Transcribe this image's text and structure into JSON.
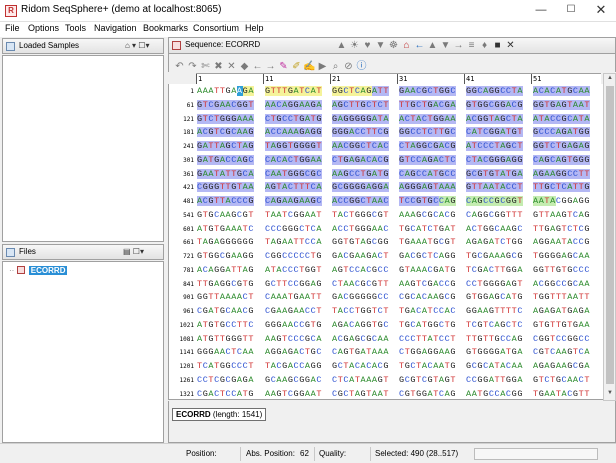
{
  "window": {
    "title": "Ridom SeqSphere+ (demo at localhost:8065)",
    "app_icon_letter": "R",
    "min_glyph": "—",
    "max_glyph": "☐",
    "close_glyph": "✕"
  },
  "menu": [
    "File",
    "Options",
    "Tools",
    "Navigation",
    "Bookmarks",
    "Consortium",
    "Help"
  ],
  "panels": {
    "loaded_samples": {
      "title": "Loaded Samples",
      "controls": "⌂ ▾  ☐▾"
    },
    "files": {
      "title": "Files",
      "controls": "▤  ☐▾",
      "tree_dots": "··",
      "tree_item": "ECORRD"
    }
  },
  "sequence_panel": {
    "title": "Sequence: ECORRD",
    "header_icons": [
      "▲",
      "☀",
      "♥",
      "▼",
      "☸",
      "⌂",
      "←",
      "▲",
      "▼",
      "→",
      "≡",
      "♦",
      "■",
      "✕"
    ],
    "toolbar_icons": [
      "↶",
      "↷",
      "✄",
      "✖",
      "✕",
      "◆",
      "←",
      "→",
      "✎",
      "✐",
      "✍",
      "▶",
      "⌕",
      "⊘",
      "ⓘ"
    ],
    "info_name": "ECORRD",
    "info_length": "(length: 1541)"
  },
  "ruler": {
    "marks": [
      "1",
      "11",
      "21",
      "31",
      "41",
      "51"
    ]
  },
  "sequence_rows": [
    {
      "num": "1",
      "blocks": [
        "AAATTGAAGA",
        "GTTTGATCAT",
        "GGCTCAGATT",
        "GAACGCTGGC",
        "GGCAGGCCTA",
        "ACACATGCAA"
      ]
    },
    {
      "num": "61",
      "blocks": [
        "GTCGAACGGT",
        "AACAGGAAGA",
        "AGCTTGCTCT",
        "TTGCTGACGA",
        "GTGGCGGACG",
        "GGTGAGTAAT"
      ]
    },
    {
      "num": "121",
      "blocks": [
        "GTCTGGGAAA",
        "CTGCCTGATG",
        "GAGGGGGATA",
        "ACTACTGGAA",
        "ACGGTAGCTA",
        "ATACCGCATA"
      ]
    },
    {
      "num": "181",
      "blocks": [
        "ACGTCGCAAG",
        "ACCAAAGAGG",
        "GGGACCTTCG",
        "GGCCTCTTGC",
        "CATCGGATGT",
        "GCCCAGATGG"
      ]
    },
    {
      "num": "241",
      "blocks": [
        "GATTAGCTAG",
        "TAGGTGGGGT",
        "AACGGCTCAC",
        "CTAGGCGACG",
        "ATCCCTAGCT",
        "GGTCTGAGAG"
      ]
    },
    {
      "num": "301",
      "blocks": [
        "GATGACCAGC",
        "CACACTGGAA",
        "CTGAGACACG",
        "GTCCAGACTC",
        "CTACGGGAGG",
        "CAGCAGTGGG"
      ]
    },
    {
      "num": "361",
      "blocks": [
        "GAATATTGCA",
        "CAATGGGCGC",
        "AAGCCTGATG",
        "CAGCCATGCC",
        "GCGTGTATGA",
        "AGAAGGCCTT"
      ]
    },
    {
      "num": "421",
      "blocks": [
        "CGGGTTGTAA",
        "AGTACTTTCA",
        "GCGGGGAGGA",
        "AGGGAGTAAA",
        "GTTAATACCT",
        "TTGCTCATTG"
      ]
    },
    {
      "num": "481",
      "blocks": [
        "ACGTTACCCG",
        "CAGAAGAAGC",
        "ACCGGCTAAC",
        "TCCGTGCCAG",
        "CAGCCGCGGT",
        "AATACGGAGG"
      ]
    },
    {
      "num": "541",
      "blocks": [
        "GTGCAAGCGT",
        "TAATCGGAAT",
        "TACTGGGCGT",
        "AAAGCGCACG",
        "CAGGCGGTTT",
        "GTTAAGTCAG"
      ]
    },
    {
      "num": "601",
      "blocks": [
        "ATGTGAAATC",
        "CCCGGGCTCA",
        "ACCTGGGAAC",
        "TGCATCTGAT",
        "ACTGGCAAGC",
        "TTGAGTCTCG"
      ]
    },
    {
      "num": "661",
      "blocks": [
        "TAGAGGGGGG",
        "TAGAATTCCA",
        "GGTGTAGCGG",
        "TGAAATGCGT",
        "AGAGATCTGG",
        "AGGAATACCG"
      ]
    },
    {
      "num": "721",
      "blocks": [
        "GTGGCGAAGG",
        "CGGCCCCCTG",
        "GACGAAGACT",
        "GACGCTCAGG",
        "TGCGAAAGCG",
        "TGGGGAGCAA"
      ]
    },
    {
      "num": "781",
      "blocks": [
        "ACAGGATTAG",
        "ATACCCTGGT",
        "AGTCCACGCC",
        "GTAAACGATG",
        "TCGACTTGGA",
        "GGTTGTGCCC"
      ]
    },
    {
      "num": "841",
      "blocks": [
        "TTGAGGCGTG",
        "GCTTCCGGAG",
        "CTAACGCGTT",
        "AAGTCGACCG",
        "CCTGGGGAGT",
        "ACGGCCGCAA"
      ]
    },
    {
      "num": "901",
      "blocks": [
        "GGTTAAAACT",
        "CAAATGAATT",
        "GACGGGGGCC",
        "CGCACAAGCG",
        "GTGGAGCATG",
        "TGGTTTAATT"
      ]
    },
    {
      "num": "961",
      "blocks": [
        "CGATGCAACG",
        "CGAAGAACCT",
        "TACCTGGTCT",
        "TGACATCCAC",
        "GGAAGTTTTC",
        "AGAGATGAGA"
      ]
    },
    {
      "num": "1021",
      "blocks": [
        "ATGTGCCTTC",
        "GGGAACCGTG",
        "AGACAGGTGC",
        "TGCATGGCTG",
        "TCGTCAGCTC",
        "GTGTTGTGAA"
      ]
    },
    {
      "num": "1081",
      "blocks": [
        "ATGTTGGGTT",
        "AAGTCCCGCA",
        "ACGAGCGCAA",
        "CCCTTATCCT",
        "TTGTTGCCAG",
        "CGGTCCGGCC"
      ]
    },
    {
      "num": "1141",
      "blocks": [
        "GGGAACTCAA",
        "AGGAGACTGC",
        "CAGTGATAAA",
        "CTGGAGGAAG",
        "GTGGGGATGA",
        "CGTCAAGTCA"
      ]
    },
    {
      "num": "1201",
      "blocks": [
        "TCATGGCCCT",
        "TACGACCAGG",
        "GCTACACACG",
        "TGCTACAATG",
        "GCGCATACAA",
        "AGAGAAGCGA"
      ]
    },
    {
      "num": "1261",
      "blocks": [
        "CCTCGCGAGA",
        "GCAAGCGGAC",
        "CTCATAAAGT",
        "GCGTCGTAGT",
        "CCGGATTGGA",
        "GTCTGCAACT"
      ]
    },
    {
      "num": "1321",
      "blocks": [
        "CGACTCCATG",
        "AAGTCGGAAT",
        "CGCTAGTAAT",
        "CGTGGATCAG",
        "AATGCCACGG",
        "TGAATACGTT"
      ]
    }
  ],
  "status": {
    "position_label": "Position:",
    "abs_position_label": "Abs. Position:",
    "abs_position_value": "62",
    "quality_label": "Quality:",
    "selected": "Selected: 490 (28..517)"
  }
}
